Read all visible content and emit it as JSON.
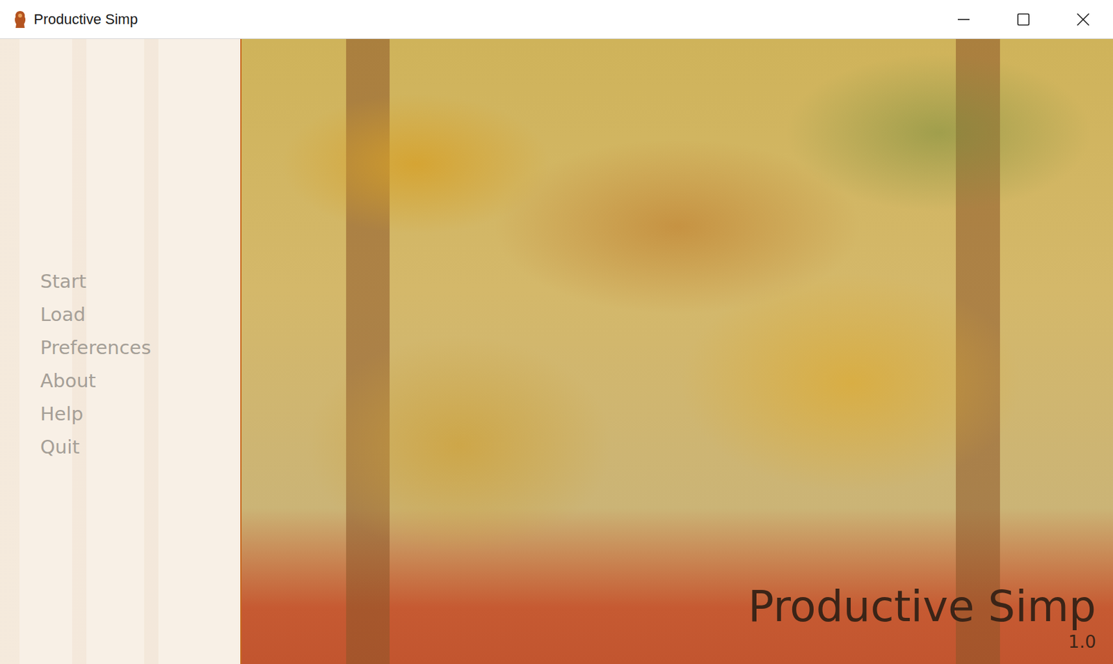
{
  "window": {
    "title": "Productive Simp"
  },
  "menu": {
    "items": [
      {
        "label": "Start"
      },
      {
        "label": "Load"
      },
      {
        "label": "Preferences"
      },
      {
        "label": "About"
      },
      {
        "label": "Help"
      },
      {
        "label": "Quit"
      }
    ]
  },
  "game": {
    "title": "Productive Simp",
    "version": "1.0"
  }
}
